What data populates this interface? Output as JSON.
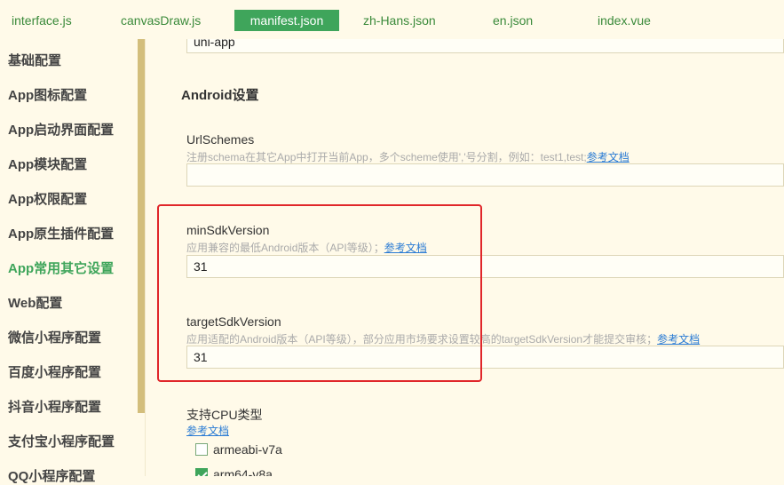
{
  "tabs": [
    {
      "label": "interface.js",
      "active": false
    },
    {
      "label": "canvasDraw.js",
      "active": false
    },
    {
      "label": "manifest.json",
      "active": true
    },
    {
      "label": "zh-Hans.json",
      "active": false
    },
    {
      "label": "en.json",
      "active": false
    },
    {
      "label": "index.vue",
      "active": false
    }
  ],
  "sidebar": {
    "items": [
      "基础配置",
      "App图标配置",
      "App启动界面配置",
      "App模块配置",
      "App权限配置",
      "App原生插件配置",
      "App常用其它设置",
      "Web配置",
      "微信小程序配置",
      "百度小程序配置",
      "抖音小程序配置",
      "支付宝小程序配置",
      "QQ小程序配置"
    ],
    "active_index": 6
  },
  "main": {
    "top_input_value": "uni-app",
    "section_title": "Android设置",
    "url_schemes": {
      "label": "UrlSchemes",
      "hint": "注册schema在其它App中打开当前App，多个scheme使用','号分割，例如：test1,test;",
      "link": "参考文档",
      "value": ""
    },
    "min_sdk": {
      "label": "minSdkVersion",
      "hint": "应用兼容的最低Android版本（API等级）；",
      "link": "参考文档",
      "value": "31"
    },
    "target_sdk": {
      "label": "targetSdkVersion",
      "hint": "应用适配的Android版本（API等级），部分应用市场要求设置较高的targetSdkVersion才能提交审核；",
      "link": "参考文档",
      "value": "31"
    },
    "cpu": {
      "label": "支持CPU类型",
      "link": "参考文档",
      "options": [
        {
          "label": "armeabi-v7a",
          "checked": false
        },
        {
          "label": "arm64-v8a",
          "checked": true
        }
      ]
    }
  },
  "colors": {
    "accent": "#3fa55b",
    "highlight": "#e0262a",
    "link": "#2a7bd4",
    "background": "#fffae9"
  }
}
